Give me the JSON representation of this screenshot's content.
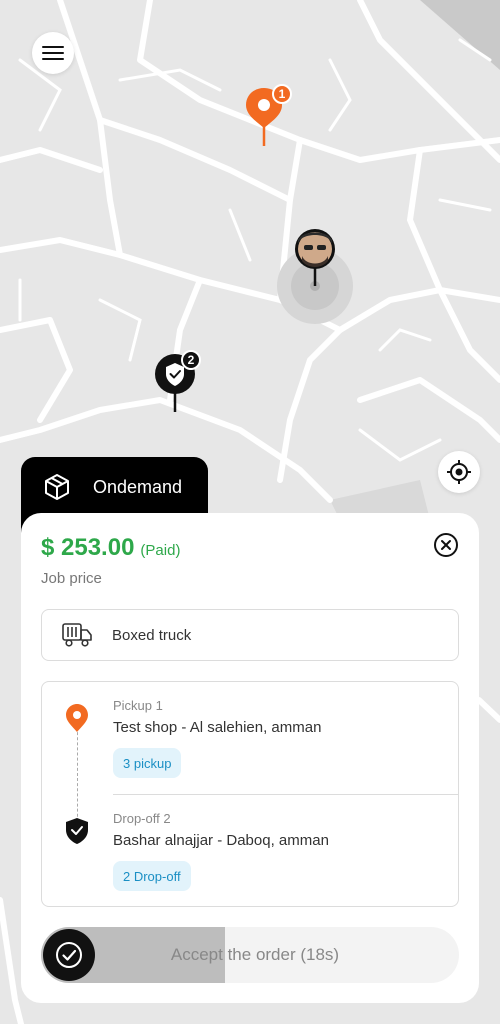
{
  "map": {
    "pickup_badge": "1",
    "dropoff_badge": "2"
  },
  "tab": {
    "label": "Ondemand"
  },
  "job": {
    "price": "$ 253.00",
    "paid_status": "(Paid)",
    "price_label": "Job price"
  },
  "vehicle": {
    "label": "Boxed truck"
  },
  "stops": [
    {
      "title": "Pickup 1",
      "address": "Test shop - Al salehien, amman",
      "chip": "3 pickup"
    },
    {
      "title": "Drop-off 2",
      "address": "Bashar alnajjar - Daboq, amman",
      "chip": "2 Drop-off"
    }
  ],
  "accept": {
    "label": "Accept the order (18s)",
    "progress": 0.44
  },
  "colors": {
    "accent": "#f26a21",
    "price_green": "#2ea84a",
    "chip_bg": "#e2f3fb",
    "chip_text": "#1a8fc4"
  }
}
